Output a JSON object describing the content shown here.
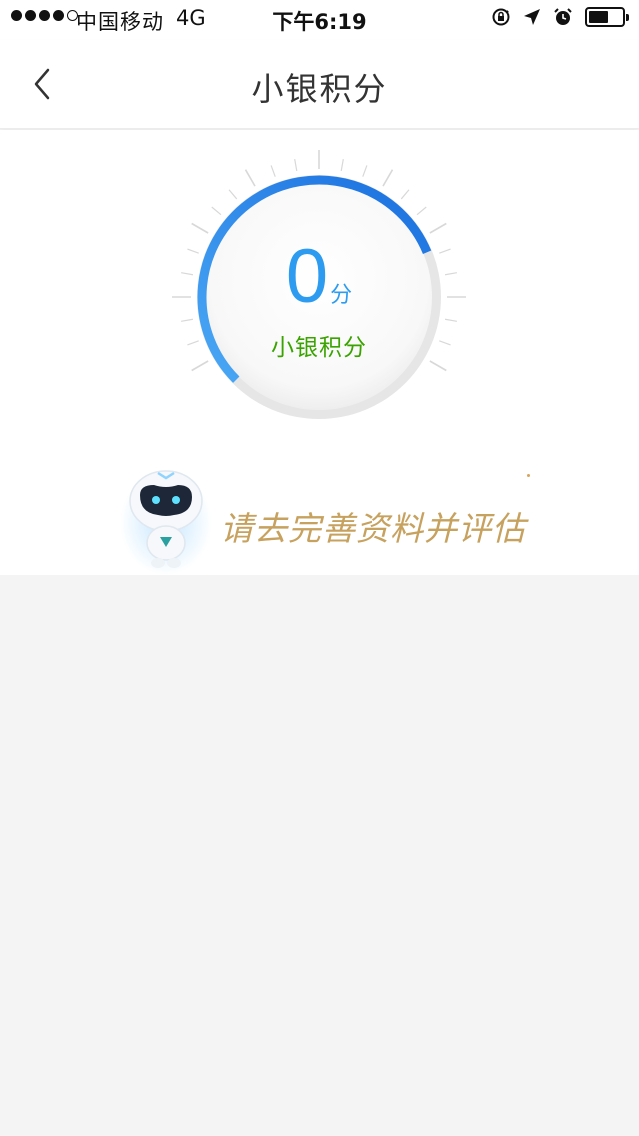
{
  "status_bar": {
    "carrier": "中国移动",
    "network": "4G",
    "time": "下午6:19",
    "battery_level": 0.6
  },
  "nav": {
    "title": "小银积分",
    "back_icon": "chevron-left-icon"
  },
  "score": {
    "value": "0",
    "unit": "分",
    "label": "小银积分",
    "arc_fraction": 0.75
  },
  "prompt": {
    "text": "请去完善资料并评估"
  },
  "colors": {
    "score_blue": "#2d9cf0",
    "arc_blue": "#1f7ae0",
    "label_green": "#3aa300",
    "prompt_gold": "#c7a15e",
    "page_bg": "#f4f4f4"
  }
}
